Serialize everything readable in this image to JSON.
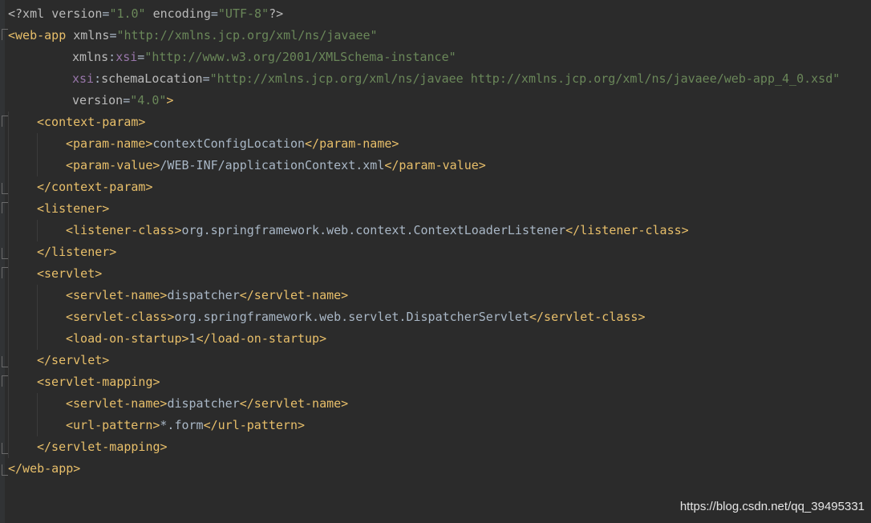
{
  "editor": {
    "prolog": {
      "open": "<?xml ",
      "attr1": "version",
      "eq1": "=",
      "val1": "\"1.0\"",
      "attr2": " encoding",
      "eq2": "=",
      "val2": "\"UTF-8\"",
      "close": "?>"
    },
    "root_open": {
      "lt": "<",
      "tag": "web-app",
      "attr": " xmlns",
      "eq": "=",
      "val": "\"http://xmlns.jcp.org/xml/ns/javaee\""
    },
    "xsi_line": {
      "attr": "xmlns",
      "colon": ":",
      "ns": "xsi",
      "eq": "=",
      "val": "\"http://www.w3.org/2001/XMLSchema-instance\""
    },
    "schema_line": {
      "ns": "xsi",
      "colon": ":",
      "attr": "schemaLocation",
      "eq": "=",
      "val": "\"http://xmlns.jcp.org/xml/ns/javaee http://xmlns.jcp.org/xml/ns/javaee/web-app_4_0.xsd\""
    },
    "version_line": {
      "attr": "version",
      "eq": "=",
      "val": "\"4.0\"",
      "gt": ">"
    },
    "lines": [
      {
        "indent": 1,
        "open": "<context-param>",
        "text": "",
        "close": ""
      },
      {
        "indent": 2,
        "open": "<param-name>",
        "text": "contextConfigLocation",
        "close": "</param-name>"
      },
      {
        "indent": 2,
        "open": "<param-value>",
        "text": "/WEB-INF/applicationContext.xml",
        "close": "</param-value>"
      },
      {
        "indent": 1,
        "open": "</context-param>",
        "text": "",
        "close": ""
      },
      {
        "indent": 1,
        "open": "<listener>",
        "text": "",
        "close": ""
      },
      {
        "indent": 2,
        "open": "<listener-class>",
        "text": "org.springframework.web.context.ContextLoaderListener",
        "close": "</listener-class>"
      },
      {
        "indent": 1,
        "open": "</listener>",
        "text": "",
        "close": ""
      },
      {
        "indent": 1,
        "open": "<servlet>",
        "text": "",
        "close": ""
      },
      {
        "indent": 2,
        "open": "<servlet-name>",
        "text": "dispatcher",
        "close": "</servlet-name>"
      },
      {
        "indent": 2,
        "open": "<servlet-class>",
        "text": "org.springframework.web.servlet.DispatcherServlet",
        "close": "</servlet-class>"
      },
      {
        "indent": 2,
        "open": "<load-on-startup>",
        "text": "1",
        "close": "</load-on-startup>"
      },
      {
        "indent": 1,
        "open": "</servlet>",
        "text": "",
        "close": ""
      },
      {
        "indent": 1,
        "open": "<servlet-mapping>",
        "text": "",
        "close": ""
      },
      {
        "indent": 2,
        "open": "<servlet-name>",
        "text": "dispatcher",
        "close": "</servlet-name>"
      },
      {
        "indent": 2,
        "open": "<url-pattern>",
        "text": "*.form",
        "close": "</url-pattern>"
      },
      {
        "indent": 1,
        "open": "</servlet-mapping>",
        "text": "",
        "close": ""
      },
      {
        "indent": 0,
        "open": "</web-app>",
        "text": "",
        "close": ""
      }
    ]
  },
  "watermark": "https://blog.csdn.net/qq_39495331",
  "colors": {
    "background": "#2b2b2b",
    "tag": "#e8bf6a",
    "attribute": "#bababa",
    "namespace": "#9876aa",
    "string": "#6a8759",
    "text": "#a9b7c6"
  }
}
